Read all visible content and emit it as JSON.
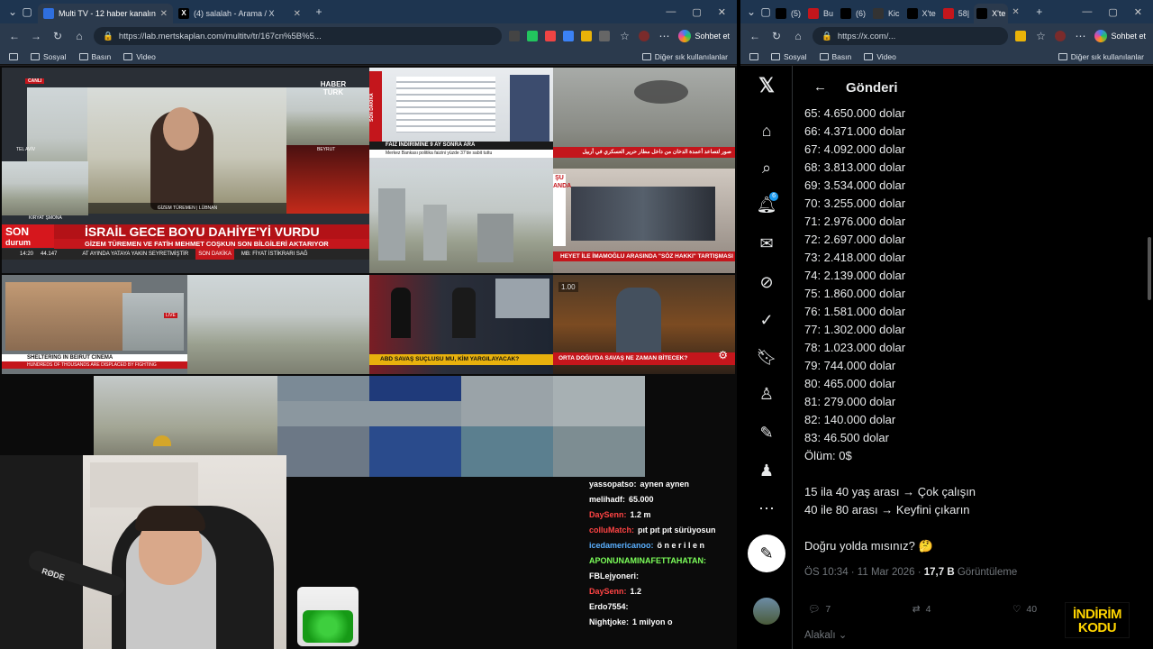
{
  "left_browser": {
    "tabs": [
      {
        "label": "Multi TV - 12 haber kanalını aynı a"
      },
      {
        "label": "(4) salalah - Arama / X"
      }
    ],
    "new_tab_label": "+",
    "url": "https://lab.mertskaplan.com/multitv/tr/167cn%5B%5...",
    "chat_button": "Sohbet et",
    "bookmarks": [
      "Sosyal",
      "Basın",
      "Video"
    ],
    "bookmarks_right": "Diğer sık kullanılanlar"
  },
  "tv": {
    "haberturk": {
      "live": "CANLI",
      "logo": "HABER TÜRK",
      "city_left_top": "TEL AVİV",
      "city_left_top_sub": "CANLI",
      "city_right_top": "BEYRUT",
      "city_right_top_sub": "CANLI",
      "city_left_bottom": "KIRYAT ŞMONA",
      "reporter_caption": "GİZEM TÜREMEN | LÜBNAN",
      "son_durum_1": "SON",
      "son_durum_2": "durum",
      "headline": "İSRAİL GECE BOYU DAHİYE'Yİ VURDU",
      "subline": "GİZEM TÜREMEN VE FATİH MEHMET COŞKUN SON BİLGİLERİ AKTARIYOR",
      "time": "14:20",
      "ticker_value": "44.147",
      "ticker_text": "AT AYINDA YATAYA YAKIN SEYRETMİŞTİR",
      "ticker_tag": "SON DAKİKA",
      "ticker_right": "MB: FİYAT İSTİKRARI SAĞ"
    },
    "cnbc": {
      "tag": "SON DAKİKA",
      "headline": "FAİZ İNDİRİMİNE 9 AY SONRA ARA",
      "sub": "Merkez Bankası politika faizini yüzde 37'de sabit tuttu"
    },
    "arabic": {
      "caption": "صور لتصاعد أعمدة الدخان من داخل مطار حرير العسكري في أربيل"
    },
    "su_anda": {
      "tag1": "ŞU",
      "tag2": "ANDA",
      "headline": "HEYET İLE İMAMOĞLU ARASINDA \"SÖZ HAKKI\" TARTIŞMASI"
    },
    "aljazeera": {
      "live": "LIVE",
      "caption": "SHELTERING IN BEIRUT CINEMA",
      "sub": "HUNDREDS OF THOUSANDS ARE DISPLACED BY FIGHTING"
    },
    "studio": {
      "headline": "ABD SAVAŞ SUÇLUSU MU, KİM YARGILAYACAK?"
    },
    "speed": {
      "badge": "1.00",
      "headline": "ORTA DOĞU'DA SAVAŞ NE ZAMAN BİTECEK?"
    }
  },
  "chat": [
    {
      "user": "yassopatso:",
      "msg": "aynen aynen",
      "color": "#ffffff"
    },
    {
      "user": "melihadf:",
      "msg": "65.000",
      "color": "#ffffff"
    },
    {
      "user": "DaySenn:",
      "msg": "1.2 m",
      "color": "#ff4444"
    },
    {
      "user": "colluMatch:",
      "msg": "pıt pıt pıt sürüyosun",
      "color": "#ff4444"
    },
    {
      "user": "icedamericanoo:",
      "msg": "ö n e r i l e n",
      "color": "#5ab0ff"
    },
    {
      "user": "APONUNAMINAFETTAHATAN:",
      "msg": "",
      "color": "#7cff5a"
    },
    {
      "user": "FBLejyoneri:",
      "msg": "",
      "color": "#ffffff"
    },
    {
      "user": "DaySenn:",
      "msg": "1.2",
      "color": "#ff4444"
    },
    {
      "user": "Erdo7554:",
      "msg": "",
      "color": "#ffffff"
    },
    {
      "user": "Nightjoke:",
      "msg": "1 milyon o",
      "color": "#ffffff"
    }
  ],
  "mic_label": "RØDE",
  "right_browser": {
    "url": "https://x.com/...",
    "chat_button": "Sohbet et",
    "bookmarks": [
      "Sosyal",
      "Basın",
      "Video"
    ],
    "bookmarks_right": "Diğer sık kullanılanlar",
    "tabs": [
      "(5)",
      "Bu",
      "(6)",
      "Kic",
      "X'te",
      "58|",
      "X'te"
    ]
  },
  "x": {
    "notif_count": "6",
    "page_title": "Gönderi",
    "lines": [
      "65: 4.650.000 dolar",
      "66: 4.371.000 dolar",
      "67: 4.092.000 dolar",
      "68: 3.813.000 dolar",
      "69: 3.534.000 dolar",
      "70: 3.255.000 dolar",
      "71: 2.976.000 dolar",
      "72: 2.697.000 dolar",
      "73: 2.418.000 dolar",
      "74: 2.139.000 dolar",
      "75: 1.860.000 dolar",
      "76: 1.581.000 dolar",
      "77: 1.302.000 dolar",
      "78: 1.023.000 dolar",
      "79: 744.000 dolar",
      "80: 465.000 dolar",
      "81: 279.000 dolar",
      "82: 140.000 dolar",
      "83: 46.500 dolar",
      "Ölüm: 0$",
      "",
      "15 ila 40 yaş arası → Çok çalışın",
      "40 ile 80 arası → Keyfini çıkarın",
      "",
      "Doğru yolda mısınız? 🤔"
    ],
    "timestamp": "ÖS 10:34 · 11 Mar 2026 · ",
    "views": "17,7 B",
    "views_label": " Görüntüleme",
    "replies": "7",
    "reposts": "4",
    "likes": "40",
    "bottom_text": "Alakalı"
  },
  "promo": {
    "line1": "İNDİRİM",
    "line2": "KODU"
  }
}
